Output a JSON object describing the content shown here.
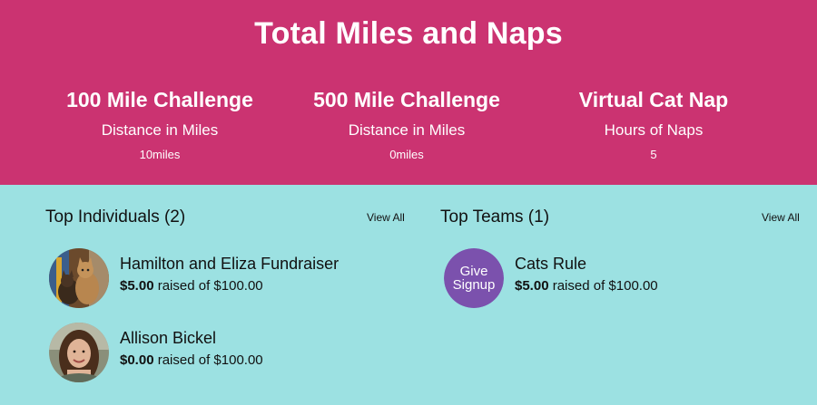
{
  "banner": {
    "title": "Total Miles and Naps",
    "stats": [
      {
        "title": "100 Mile Challenge",
        "subtitle": "Distance in Miles",
        "value": "10miles"
      },
      {
        "title": "500 Mile Challenge",
        "subtitle": "Distance in Miles",
        "value": "0miles"
      },
      {
        "title": "Virtual Cat Nap",
        "subtitle": "Hours of Naps",
        "value": "5"
      }
    ]
  },
  "individuals": {
    "title": "Top Individuals (2)",
    "view_all": "View All",
    "items": [
      {
        "name": "Hamilton and Eliza Fundraiser",
        "raised": "$5.00",
        "goal_text": "raised of $100.00"
      },
      {
        "name": "Allison Bickel",
        "raised": "$0.00",
        "goal_text": "raised of $100.00"
      }
    ]
  },
  "teams": {
    "title": "Top Teams (1)",
    "view_all": "View All",
    "items": [
      {
        "name": "Cats Rule",
        "raised": "$5.00",
        "goal_text": "raised of $100.00",
        "logo_line1": "Give",
        "logo_line2": "Signup"
      }
    ]
  },
  "colors": {
    "banner": "#cb3371",
    "background": "#9ce1e2",
    "logo": "#7b51ad"
  }
}
